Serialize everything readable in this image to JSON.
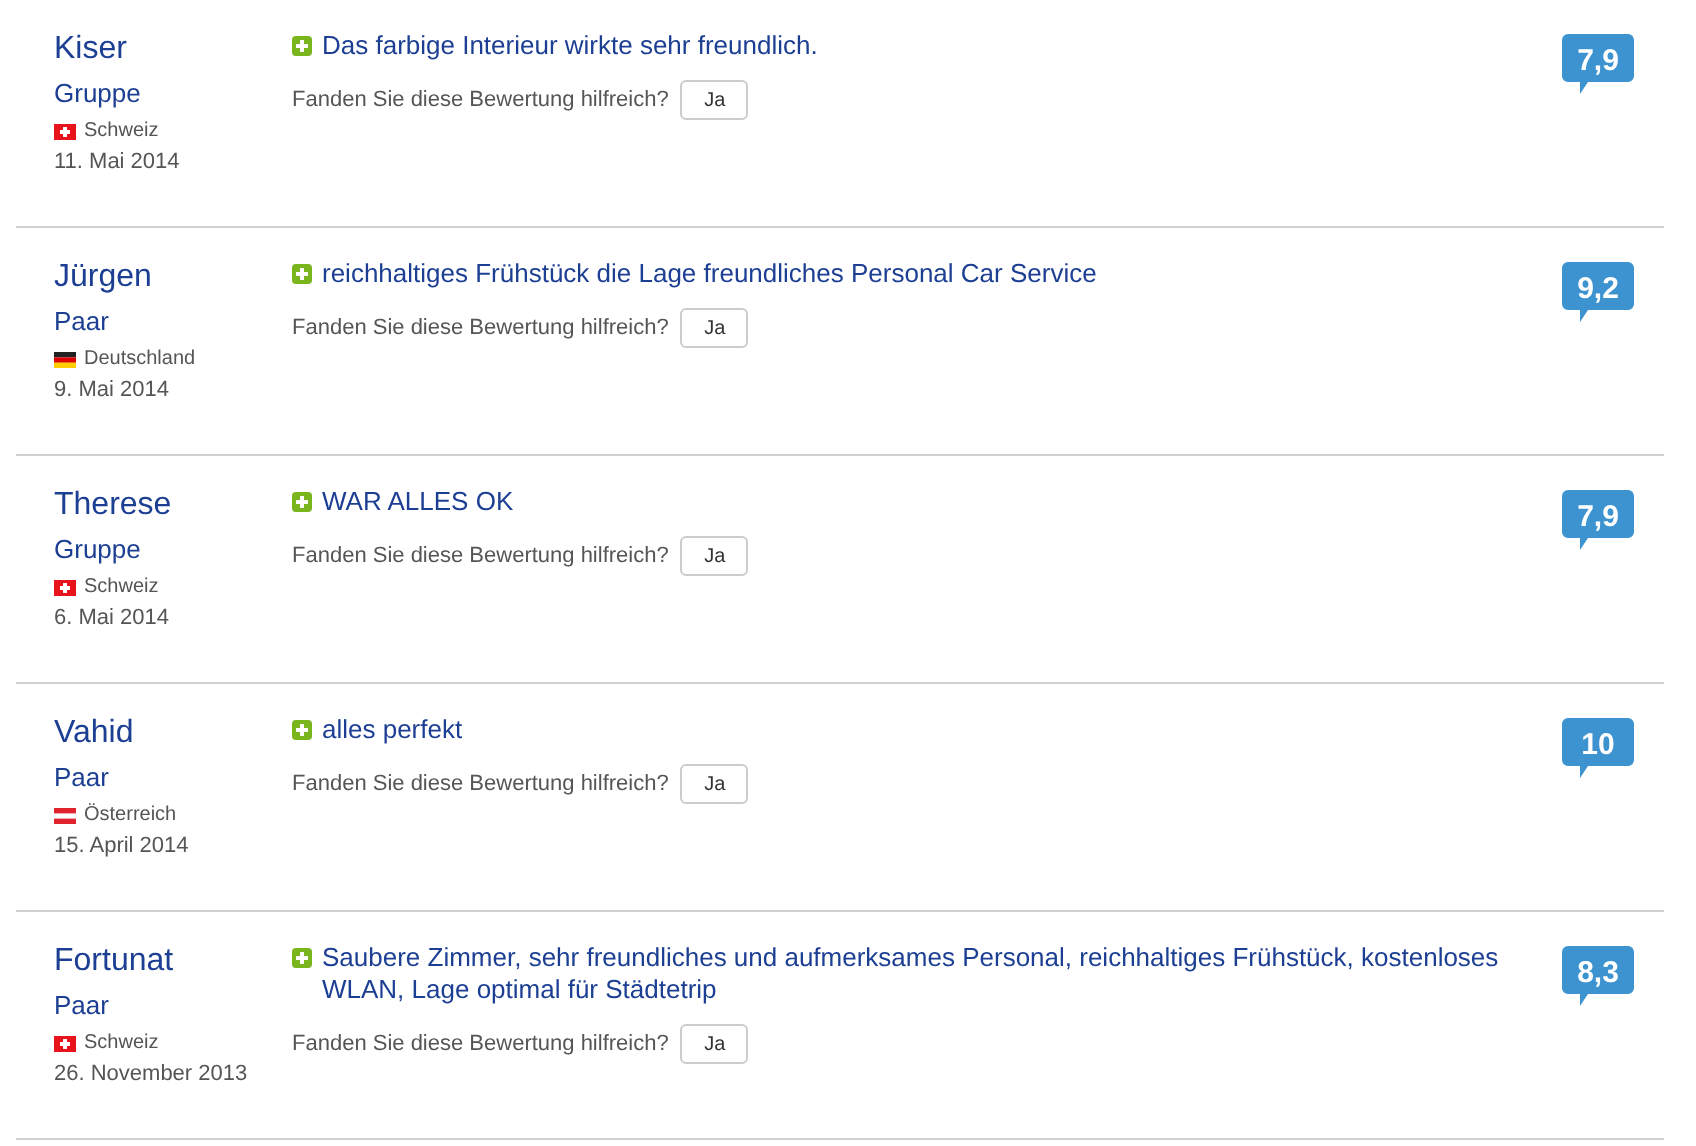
{
  "reviews": [
    {
      "name": "Kiser",
      "traveler_type": "Gruppe",
      "flag": {
        "kind": "ch"
      },
      "country": "Schweiz",
      "date": "11. Mai 2014",
      "comment": "Das farbige Interieur wirkte sehr freundlich.",
      "helpful_question": "Fanden Sie diese Bewertung hilfreich?",
      "helpful_button": "Ja",
      "score": "7,9"
    },
    {
      "name": "Jürgen",
      "traveler_type": "Paar",
      "flag": {
        "kind": "de"
      },
      "country": "Deutschland",
      "date": "9. Mai 2014",
      "comment": "reichhaltiges Frühstück die Lage freundliches Personal Car Service",
      "helpful_question": "Fanden Sie diese Bewertung hilfreich?",
      "helpful_button": "Ja",
      "score": "9,2"
    },
    {
      "name": "Therese",
      "traveler_type": "Gruppe",
      "flag": {
        "kind": "ch"
      },
      "country": "Schweiz",
      "date": "6. Mai 2014",
      "comment": "WAR ALLES OK",
      "helpful_question": "Fanden Sie diese Bewertung hilfreich?",
      "helpful_button": "Ja",
      "score": "7,9"
    },
    {
      "name": "Vahid",
      "traveler_type": "Paar",
      "flag": {
        "kind": "at"
      },
      "country": "Österreich",
      "date": "15. April 2014",
      "comment": "alles perfekt",
      "helpful_question": "Fanden Sie diese Bewertung hilfreich?",
      "helpful_button": "Ja",
      "score": "10"
    },
    {
      "name": "Fortunat",
      "traveler_type": "Paar",
      "flag": {
        "kind": "ch"
      },
      "country": "Schweiz",
      "date": "26. November 2013",
      "comment": "Saubere Zimmer, sehr freundliches und aufmerksames Personal, reichhaltiges Frühstück, kostenloses WLAN, Lage optimal für Städtetrip",
      "helpful_question": "Fanden Sie diese Bewertung hilfreich?",
      "helpful_button": "Ja",
      "score": "8,3"
    }
  ]
}
